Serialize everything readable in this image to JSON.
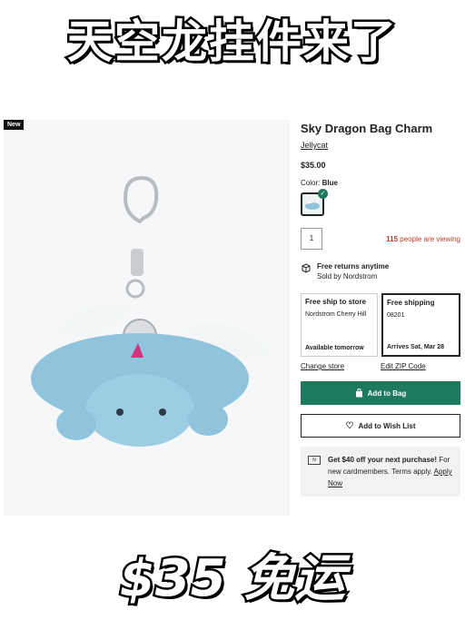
{
  "headline": "天空龙挂件来了",
  "badge": "New",
  "product": {
    "title": "Sky Dragon Bag Charm",
    "brand": "Jellycat",
    "price": "$35.00",
    "color_label": "Color:",
    "color_value": "Blue",
    "quantity": "1",
    "viewing_count": "115",
    "viewing_text": "people are viewing"
  },
  "returns": {
    "icon": "box-return-icon",
    "title": "Free returns anytime",
    "sold_by": "Sold by Nordstrom"
  },
  "shipping": {
    "store": {
      "title": "Free ship to store",
      "location": "Nordstrom Cherry Hill",
      "eta": "Available tomorrow"
    },
    "home": {
      "title": "Free shipping",
      "zip": "08201",
      "eta": "Arrives Sat, Mar 28"
    }
  },
  "links": {
    "change_store": "Change store",
    "edit_zip": "Edit ZIP Code"
  },
  "buttons": {
    "add_to_bag": "Add to Bag",
    "wishlist": "Add to Wish List"
  },
  "promo": {
    "bold": "Get $40 off your next purchase!",
    "rest": " For new cardmembers. Terms apply. ",
    "link": "Apply Now"
  },
  "footer_banner": "$35 免运",
  "colors": {
    "accent": "#1e7a5f",
    "alert": "#c0392b"
  }
}
